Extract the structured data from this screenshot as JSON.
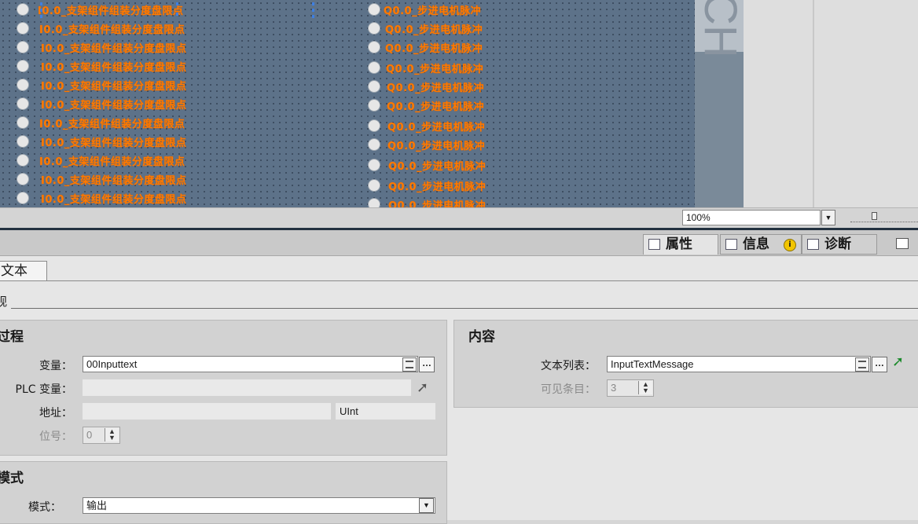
{
  "canvas": {
    "left_lamp_label": "I0.0_支架组件组装分度盘限点",
    "right_lamp_label": "Q0.0_步进电机脉冲",
    "side_watermark": "CH"
  },
  "zoom": {
    "value": "100%"
  },
  "inspector_tabs": {
    "properties": "属性",
    "info": "信息",
    "info_badge": "i",
    "diagnostics": "诊断"
  },
  "properties": {
    "subtab": "文本",
    "section_title": "观",
    "process": {
      "title": "过程",
      "variable_label": "变量：",
      "variable_value": "00Inputtext",
      "plc_variable_label": "PLC 变量：",
      "address_label": "地址：",
      "address_type": "UInt",
      "bit_label": "位号：",
      "bit_value": "0"
    },
    "content": {
      "title": "内容",
      "text_list_label": "文本列表：",
      "text_list_value": "InputTextMessage",
      "visible_entries_label": "可见条目：",
      "visible_entries_value": "3"
    },
    "mode": {
      "title": "模式",
      "mode_label": "模式：",
      "mode_value": "输出"
    }
  },
  "colors": {
    "lamp_label": "#ff7a00",
    "canvas_background": "#5d7289",
    "goto_arrow_enabled": "#1a8a2a"
  }
}
